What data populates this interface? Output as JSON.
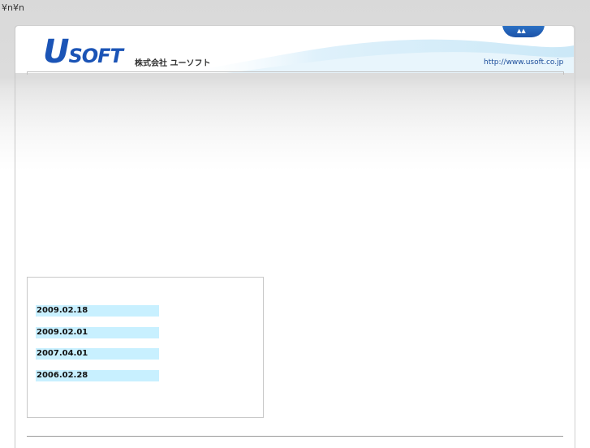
{
  "stray_text": "¥n¥n",
  "header": {
    "logo_first": "U",
    "logo_rest": "SOFT",
    "company_name": "株式会社 ユーソフト",
    "url": "http://www.usoft.co.jp",
    "tab_icon": "mountain-icon"
  },
  "news": {
    "dates": [
      "2009.02.18",
      "2009.02.01",
      "2007.04.01",
      "2006.02.28"
    ]
  },
  "colors": {
    "brand_blue": "#1b54b6",
    "news_highlight": "#c8f0ff"
  }
}
